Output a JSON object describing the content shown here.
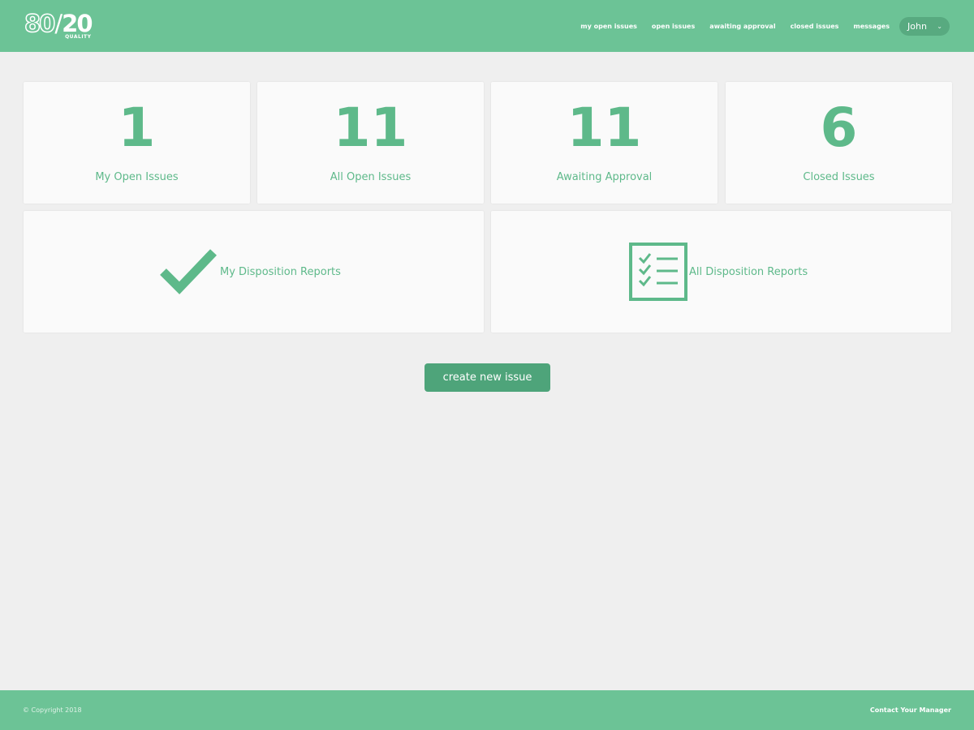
{
  "header": {
    "logo": {
      "main_left": "80",
      "main_right": "20",
      "sub": "QUALITY"
    },
    "nav": [
      {
        "label": "my open issues"
      },
      {
        "label": "open issues"
      },
      {
        "label": "awaiting approval"
      },
      {
        "label": "closed issues"
      },
      {
        "label": "messages"
      }
    ],
    "user": {
      "name": "John",
      "dropdown_icon": "chevron-down-icon"
    }
  },
  "stats": [
    {
      "value": "1",
      "label": "My Open Issues"
    },
    {
      "value": "11",
      "label": "All Open Issues"
    },
    {
      "value": "11",
      "label": "Awaiting Approval"
    },
    {
      "value": "6",
      "label": "Closed Issues"
    }
  ],
  "reports": [
    {
      "label": "My Disposition Reports",
      "icon": "checkmark-icon"
    },
    {
      "label": "All Disposition Reports",
      "icon": "checklist-icon"
    }
  ],
  "actions": {
    "create_label": "create new issue"
  },
  "footer": {
    "copyright": "© Copyright 2018",
    "contact": "Contact Your Manager"
  },
  "colors": {
    "brand": "#6cc396",
    "accent": "#5eb98a",
    "button": "#4ea47a",
    "background": "#efefef",
    "card": "#fafafa"
  }
}
